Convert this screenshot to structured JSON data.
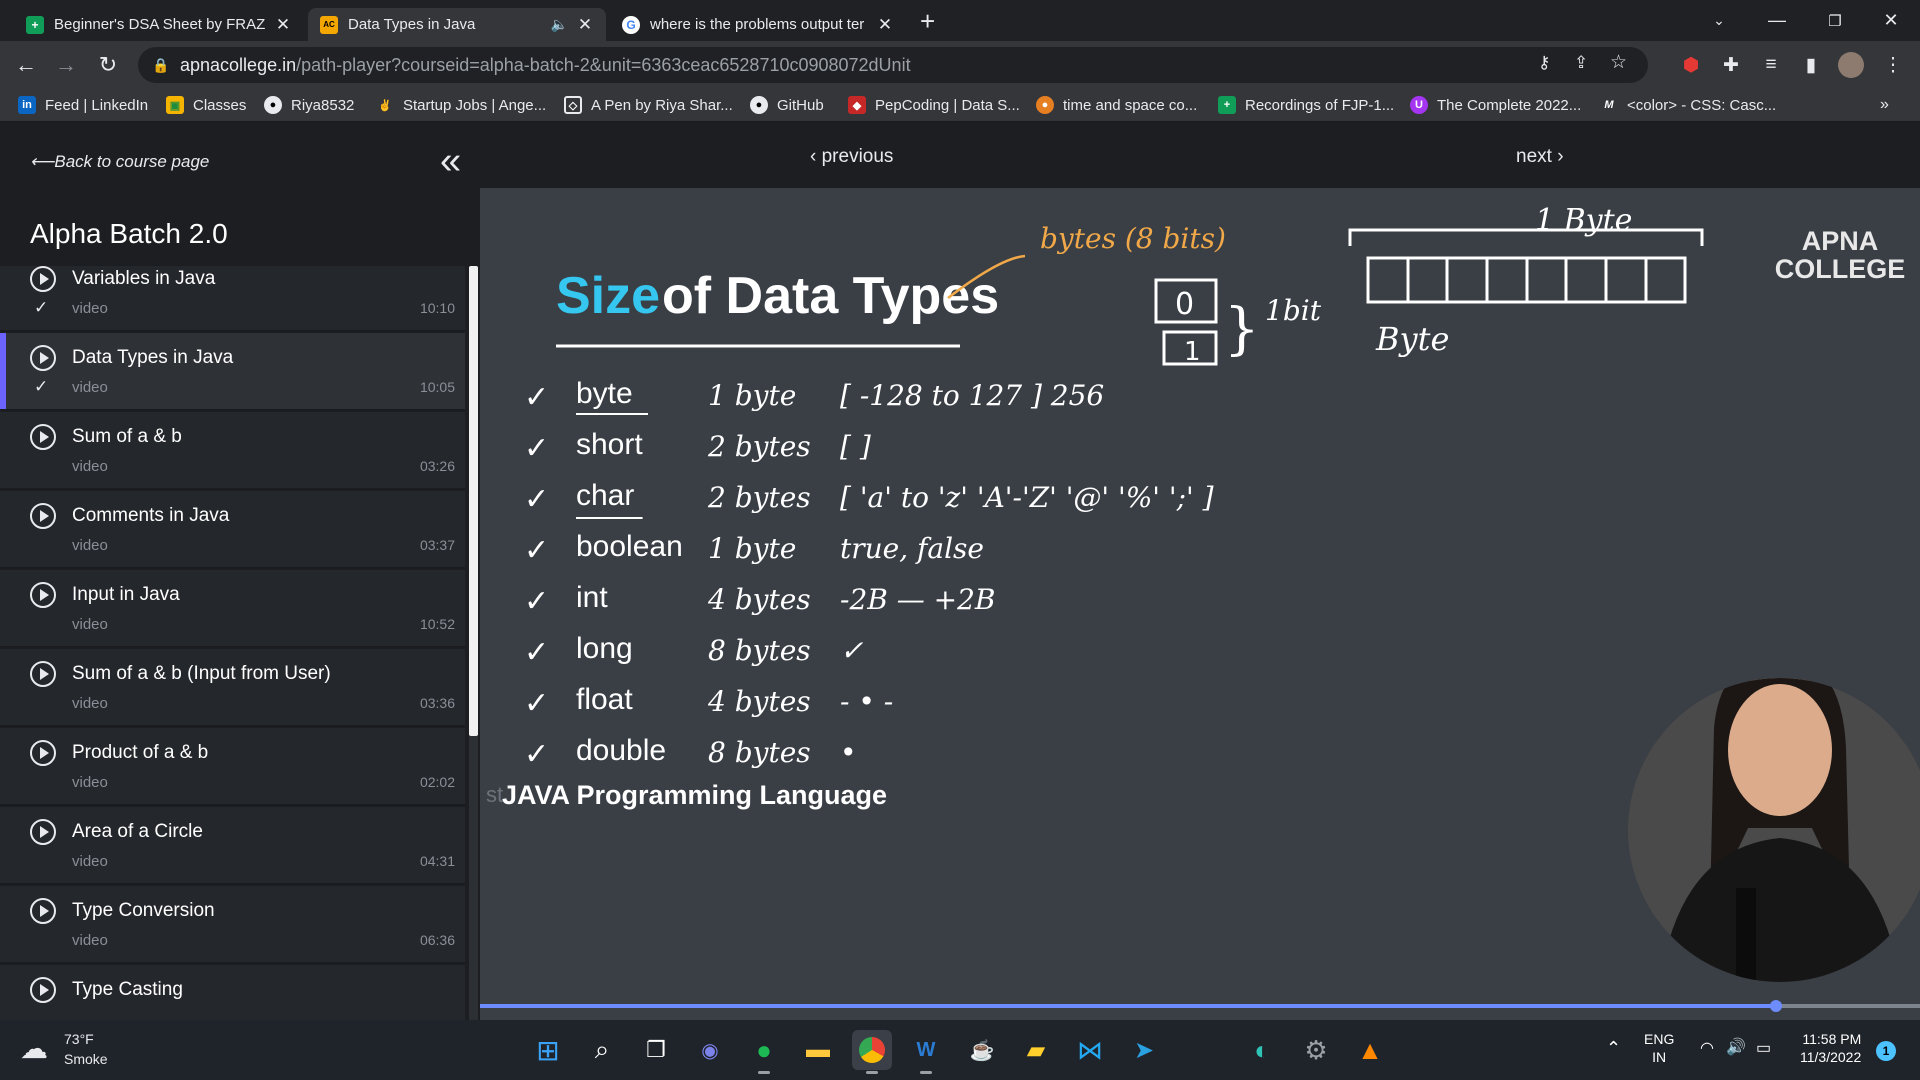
{
  "browser": {
    "tabs": [
      {
        "title": "Beginner's DSA Sheet by FRAZ -",
        "icon": "google-sheets-icon",
        "color": "#0f9d58"
      },
      {
        "title": "Data Types in Java",
        "icon": "apna-college-icon",
        "color": "#f4a700",
        "audio": "🔈"
      },
      {
        "title": "where is the problems output ter",
        "icon": "google-icon",
        "color": "#ffffff"
      }
    ],
    "url_host": "apnacollege.in",
    "url_path": "/path-player?courseid=alpha-batch-2&unit=6363ceac6528710c0908072dUnit",
    "bookmarks": [
      {
        "label": "Feed | LinkedIn",
        "icon": "linkedin-icon",
        "color": "#0a66c2"
      },
      {
        "label": "Classes",
        "icon": "classroom-icon",
        "color": "#1e8e3e"
      },
      {
        "label": "Riya8532",
        "icon": "github-icon",
        "color": "#24292e"
      },
      {
        "label": "Startup Jobs | Ange...",
        "icon": "angel-icon",
        "color": "#35363a"
      },
      {
        "label": "A Pen by Riya Shar...",
        "icon": "codepen-icon",
        "color": "#35363a"
      },
      {
        "label": "GitHub",
        "icon": "github-icon",
        "color": "#24292e"
      },
      {
        "label": "PepCoding | Data S...",
        "icon": "pepcoding-icon",
        "color": "#c62828"
      },
      {
        "label": "time and space co...",
        "icon": "geeks-icon",
        "color": "#e67e22"
      },
      {
        "label": "Recordings of FJP-1...",
        "icon": "sheets-icon",
        "color": "#0f9d58"
      },
      {
        "label": "The Complete 2022...",
        "icon": "udemy-icon",
        "color": "#a435f0"
      },
      {
        "label": "<color> - CSS: Casc...",
        "icon": "mdn-icon",
        "color": "#35363a"
      }
    ]
  },
  "sidebar": {
    "back_label": "Back to course page",
    "course_title": "Alpha Batch 2.0",
    "lessons": [
      {
        "title": "Variables in Java",
        "kind": "video",
        "duration": "10:10",
        "done": "✓"
      },
      {
        "title": "Data Types in Java",
        "kind": "video",
        "duration": "10:05",
        "done": "✓"
      },
      {
        "title": "Sum of a & b",
        "kind": "video",
        "duration": "03:26",
        "done": ""
      },
      {
        "title": "Comments in Java",
        "kind": "video",
        "duration": "03:37",
        "done": ""
      },
      {
        "title": "Input in Java",
        "kind": "video",
        "duration": "10:52",
        "done": ""
      },
      {
        "title": "Sum of a & b (Input from User)",
        "kind": "video",
        "duration": "03:36",
        "done": ""
      },
      {
        "title": "Product of a & b",
        "kind": "video",
        "duration": "02:02",
        "done": ""
      },
      {
        "title": "Area of a Circle",
        "kind": "video",
        "duration": "04:31",
        "done": ""
      },
      {
        "title": "Type Conversion",
        "kind": "video",
        "duration": "06:36",
        "done": ""
      },
      {
        "title": "Type Casting",
        "kind": "video",
        "duration": "",
        "done": ""
      }
    ]
  },
  "player": {
    "prev_label": "previous",
    "next_label": "next",
    "slide_title_a": "Size",
    "slide_title_b": "of Data Types",
    "brand_line1": "APNA",
    "brand_line2": "COLLEGE",
    "footer": "JAVA Programming Language",
    "footer_prefix": "st",
    "types": [
      "byte",
      "short",
      "char",
      "boolean",
      "int",
      "long",
      "float",
      "double"
    ],
    "sizes": [
      "1 byte",
      "2 bytes",
      "2 bytes",
      "1 byte",
      "4 bytes",
      "8 bytes",
      "4 bytes",
      "8 bytes"
    ],
    "ranges": [
      "[ -128 to 127 ]  256",
      "[                    ]",
      "[ 'a' to 'z'  'A'-'Z'  '@'  '%'  ';' ]",
      "true, false",
      "-2B — +2B",
      "✓",
      "- • -",
      "•"
    ],
    "annot_bytes": "bytes (8 bits)",
    "annot_byte_top": "1 Byte",
    "annot_byte": "Byte",
    "annot_bit": "1bit",
    "bit_0": "0",
    "bit_1": "1",
    "progress": 0.9
  },
  "taskbar": {
    "weather_temp": "73°F",
    "weather_desc": "Smoke",
    "lang1": "ENG",
    "lang2": "IN",
    "time": "11:58 PM",
    "date": "11/3/2022",
    "notifications": "1"
  }
}
